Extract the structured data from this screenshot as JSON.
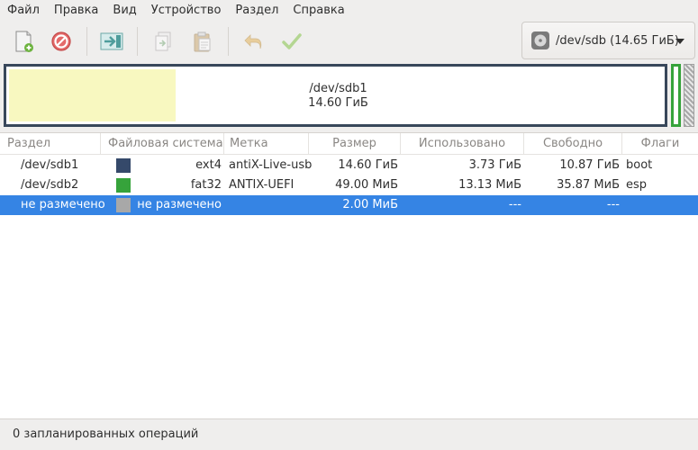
{
  "menubar": {
    "items": [
      "Файл",
      "Правка",
      "Вид",
      "Устройство",
      "Раздел",
      "Справка"
    ]
  },
  "toolbar": {
    "buttons": [
      {
        "icon": "new-partition-icon",
        "enabled": true
      },
      {
        "icon": "delete-partition-icon",
        "enabled": true
      },
      {
        "icon": "resize-move-icon",
        "enabled": true
      },
      {
        "icon": "copy-icon",
        "enabled": false
      },
      {
        "icon": "paste-icon",
        "enabled": false
      },
      {
        "icon": "undo-icon",
        "enabled": false
      },
      {
        "icon": "apply-icon",
        "enabled": false
      }
    ],
    "device": "/dev/sdb (14.65 ГиБ)"
  },
  "partition_map": {
    "name": "/dev/sdb1",
    "size": "14.60 ГиБ",
    "colors": {
      "border": "#38475a",
      "used": "#f8f8c0",
      "fat32": "#36a33b"
    }
  },
  "table": {
    "headers": [
      "Раздел",
      "Файловая система",
      "Метка",
      "Размер",
      "Использовано",
      "Свободно",
      "Флаги"
    ],
    "rows": [
      {
        "partition": "/dev/sdb1",
        "fs_color": "#35496a",
        "filesystem": "ext4",
        "label": "antiX-Live-usb",
        "size": "14.60 ГиБ",
        "used": "3.73 ГиБ",
        "free": "10.87 ГиБ",
        "flags": "boot",
        "selected": false
      },
      {
        "partition": "/dev/sdb2",
        "fs_color": "#36a33b",
        "filesystem": "fat32",
        "label": "ANTIX-UEFI",
        "size": "49.00 МиБ",
        "used": "13.13 МиБ",
        "free": "35.87 МиБ",
        "flags": "esp",
        "selected": false
      },
      {
        "partition": "не размечено",
        "fs_color": "#a8a8a8",
        "filesystem": "не размечено",
        "label": "",
        "size": "2.00 МиБ",
        "used": "---",
        "free": "---",
        "flags": "",
        "selected": true
      }
    ]
  },
  "statusbar": {
    "text": "0 запланированных операций"
  },
  "accent_color": "#3584e4"
}
